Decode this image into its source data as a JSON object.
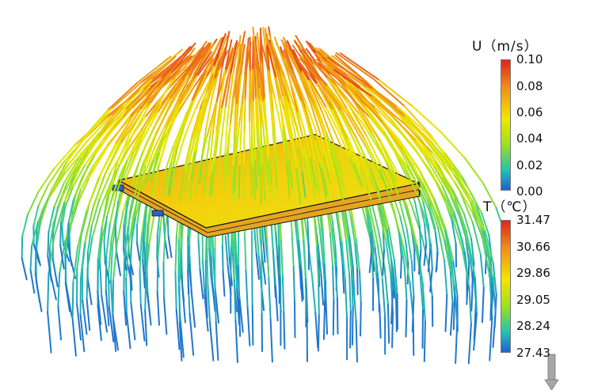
{
  "velocity_legend": {
    "title": "U（m/s）",
    "ticks": [
      "0.10",
      "0.08",
      "0.06",
      "0.04",
      "0.02",
      "0.00"
    ]
  },
  "temperature_legend": {
    "title": "T（℃）",
    "ticks": [
      "31.47",
      "30.66",
      "29.86",
      "29.05",
      "28.24",
      "27.43"
    ]
  },
  "colors": {
    "max": "#e0241b",
    "high": "#f08a1a",
    "mid": "#f2e600",
    "low_mid": "#9be11e",
    "low": "#22c3b0",
    "min": "#1f5fd6"
  }
}
